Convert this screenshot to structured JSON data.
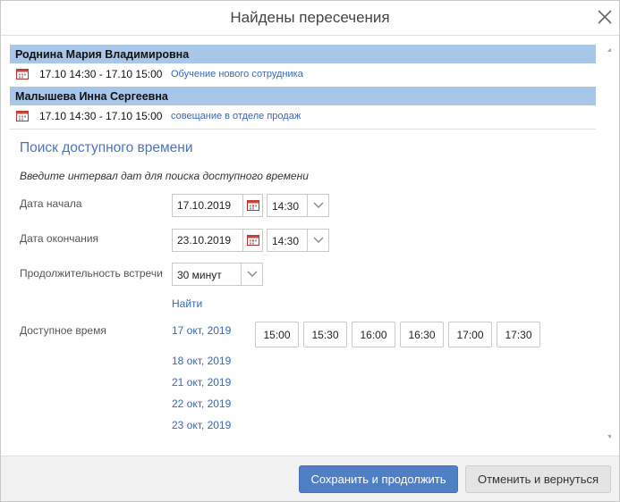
{
  "dialog": {
    "title": "Найдены пересечения"
  },
  "conflicts": [
    {
      "person": "Роднина Мария Владимировна",
      "event_time": "17.10 14:30 - 17.10 15:00",
      "event_title": "Обучение нового сотрудника"
    },
    {
      "person": "Малышева Инна Сергеевна",
      "event_time": "17.10 14:30 - 17.10 15:00",
      "event_title": "совещание в отделе продаж"
    }
  ],
  "search": {
    "title": "Поиск доступного времени",
    "hint": "Введите интервал дат для поиска доступного времени",
    "start_label": "Дата начала",
    "start_date": "17.10.2019",
    "start_time": "14:30",
    "end_label": "Дата окончания",
    "end_date": "23.10.2019",
    "end_time": "14:30",
    "duration_label": "Продолжительность встречи",
    "duration_value": "30 минут",
    "find_label": "Найти"
  },
  "available": {
    "label": "Доступное время",
    "dates": [
      "17 окт, 2019",
      "18 окт, 2019",
      "21 окт, 2019",
      "22 окт, 2019",
      "23 окт, 2019"
    ],
    "slots": [
      "15:00",
      "15:30",
      "16:00",
      "16:30",
      "17:00",
      "17:30"
    ]
  },
  "footer": {
    "save_label": "Сохранить и продолжить",
    "cancel_label": "Отменить и вернуться"
  },
  "colors": {
    "accent": "#4f80c6",
    "link": "#3a67b5",
    "person_header_bg": "#a8c6e8"
  }
}
